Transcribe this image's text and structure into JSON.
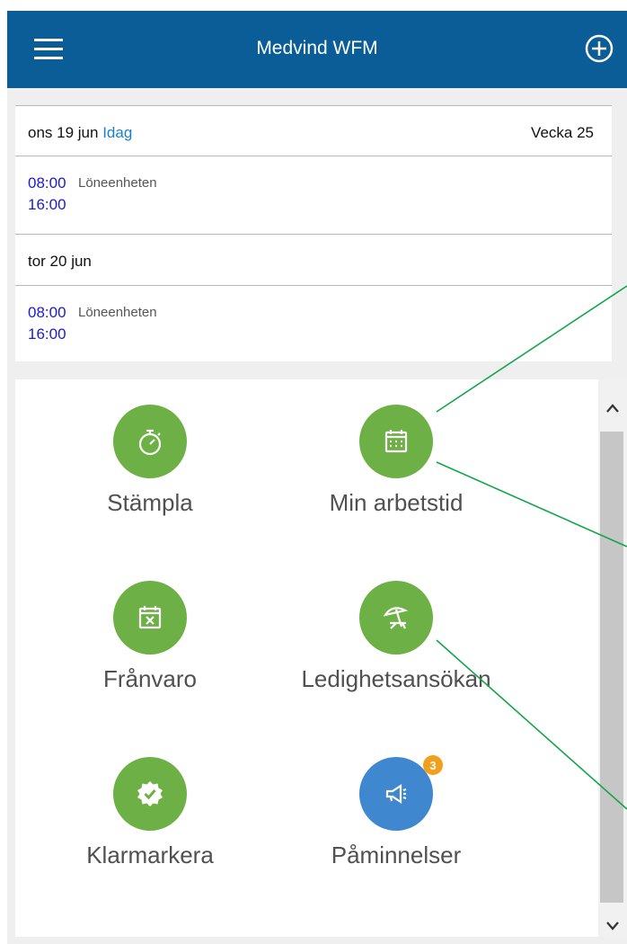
{
  "header": {
    "title": "Medvind WFM",
    "menu_icon": "hamburger-menu-icon",
    "add_icon": "plus-circle-icon",
    "color": "#0a5d96"
  },
  "schedule": {
    "days": [
      {
        "date": "ons 19 jun",
        "today_label": "Idag",
        "week_label": "Vecka 25",
        "shift": {
          "start": "08:00",
          "end": "16:00",
          "unit": "Löneenheten"
        }
      },
      {
        "date": "tor 20 jun",
        "shift": {
          "start": "08:00",
          "end": "16:00",
          "unit": "Löneenheten"
        }
      }
    ]
  },
  "tiles": [
    {
      "label": "Stämpla",
      "icon": "stopwatch-icon",
      "color": "#6db045"
    },
    {
      "label": "Min arbetstid",
      "icon": "calendar-icon",
      "color": "#6db045"
    },
    {
      "label": "Frånvaro",
      "icon": "calendar-cross-icon",
      "color": "#6db045"
    },
    {
      "label": "Ledighetsansökan",
      "icon": "beach-umbrella-icon",
      "color": "#6db045"
    },
    {
      "label": "Klarmarkera",
      "icon": "check-badge-icon",
      "color": "#6db045"
    },
    {
      "label": "Påminnelser",
      "icon": "megaphone-icon",
      "color": "#3f87cf",
      "badge": "3"
    }
  ],
  "colors": {
    "today": "#1a7fcf",
    "time": "#1a1ad8",
    "badge": "#f0a01c",
    "annotation_lines": "#12a54a"
  }
}
